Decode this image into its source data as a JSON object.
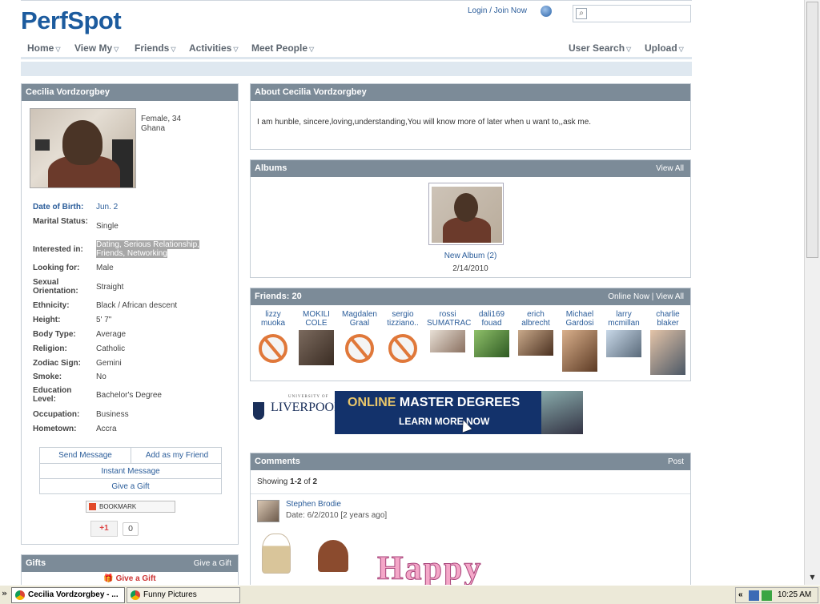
{
  "header": {
    "logo": "PerfSpot",
    "login_link": "Login / Join Now",
    "search_placeholder": ""
  },
  "nav": {
    "items": [
      "Home",
      "View My",
      "Friends",
      "Activities",
      "Meet People"
    ],
    "right_items": [
      "User Search",
      "Upload"
    ]
  },
  "profile": {
    "title": "Cecilia Vordzorgbey",
    "gender_age": "Female, 34",
    "country": "Ghana",
    "fields": [
      {
        "label": "Date of Birth:",
        "value": "Jun. 2"
      },
      {
        "label": "Marital Status:",
        "value": "Single"
      },
      {
        "label": "Interested in:",
        "value": "Dating, Serious Relationship, Friends, Networking"
      },
      {
        "label": "Looking for:",
        "value": "Male"
      },
      {
        "label": "Sexual Orientation:",
        "value": "Straight"
      },
      {
        "label": "Ethnicity:",
        "value": "Black / African descent"
      },
      {
        "label": "Height:",
        "value": "5' 7\""
      },
      {
        "label": "Body Type:",
        "value": "Average"
      },
      {
        "label": "Religion:",
        "value": "Catholic"
      },
      {
        "label": "Zodiac Sign:",
        "value": "Gemini"
      },
      {
        "label": "Smoke:",
        "value": "No"
      },
      {
        "label": "Education Level:",
        "value": "Bachelor's Degree"
      },
      {
        "label": "Occupation:",
        "value": "Business"
      },
      {
        "label": "Hometown:",
        "value": "Accra"
      }
    ],
    "actions": {
      "send_message": "Send Message",
      "add_friend": "Add as my Friend",
      "instant_message": "Instant Message",
      "give_gift": "Give a Gift"
    },
    "bookmark": "BOOKMARK",
    "gplus": "+1",
    "gplus_count": "0"
  },
  "about": {
    "title": "About Cecilia Vordzorgbey",
    "text": "I am hunble, sincere,loving,understanding,You will know more of later when u want to,,ask me."
  },
  "albums": {
    "title": "Albums",
    "view_all": "View All",
    "album_title": "New Album (2)",
    "album_date": "2/14/2010"
  },
  "friends": {
    "title": "Friends: 20",
    "online_now": "Online Now",
    "sep": "|",
    "view_all": "View All",
    "list": [
      {
        "line1": "lizzy",
        "line2": "muoka",
        "has_photo": false
      },
      {
        "line1": "MOKILI",
        "line2": "COLE",
        "has_photo": true
      },
      {
        "line1": "Magdalen",
        "line2": "Graal",
        "has_photo": false
      },
      {
        "line1": "sergio",
        "line2": "tizziano..",
        "has_photo": false
      },
      {
        "line1": "rossi",
        "line2": "SUMATRAC",
        "has_photo": true
      },
      {
        "line1": "dali169",
        "line2": "fouad",
        "has_photo": true
      },
      {
        "line1": "erich",
        "line2": "albrecht",
        "has_photo": true
      },
      {
        "line1": "Michael",
        "line2": "Gardosi",
        "has_photo": true
      },
      {
        "line1": "larry",
        "line2": "mcmillan",
        "has_photo": true
      },
      {
        "line1": "charlie",
        "line2": "blaker",
        "has_photo": true
      }
    ]
  },
  "ad": {
    "university_small": "UNIVERSITY OF",
    "university": "LIVERPOOL",
    "headline_a": "ONLINE",
    "headline_b": " MASTER DEGREES",
    "cta": "LEARN MORE NOW"
  },
  "comments": {
    "title": "Comments",
    "post": "Post",
    "showing_prefix": "Showing ",
    "showing_range": "1-2",
    "showing_of": " of ",
    "showing_total": "2",
    "author": "Stephen Brodie",
    "date": "Date: 6/2/2010 [2 years ago]",
    "happy_text": "Happy"
  },
  "gifts": {
    "title": "Gifts",
    "give_gift": "Give a Gift",
    "link": "Give a Gift"
  },
  "taskbar": {
    "tasks": [
      "Cecilia Vordzorgbey - ...",
      "Funny Pictures (i_funnypi..."
    ],
    "clock": "10:25 AM"
  }
}
